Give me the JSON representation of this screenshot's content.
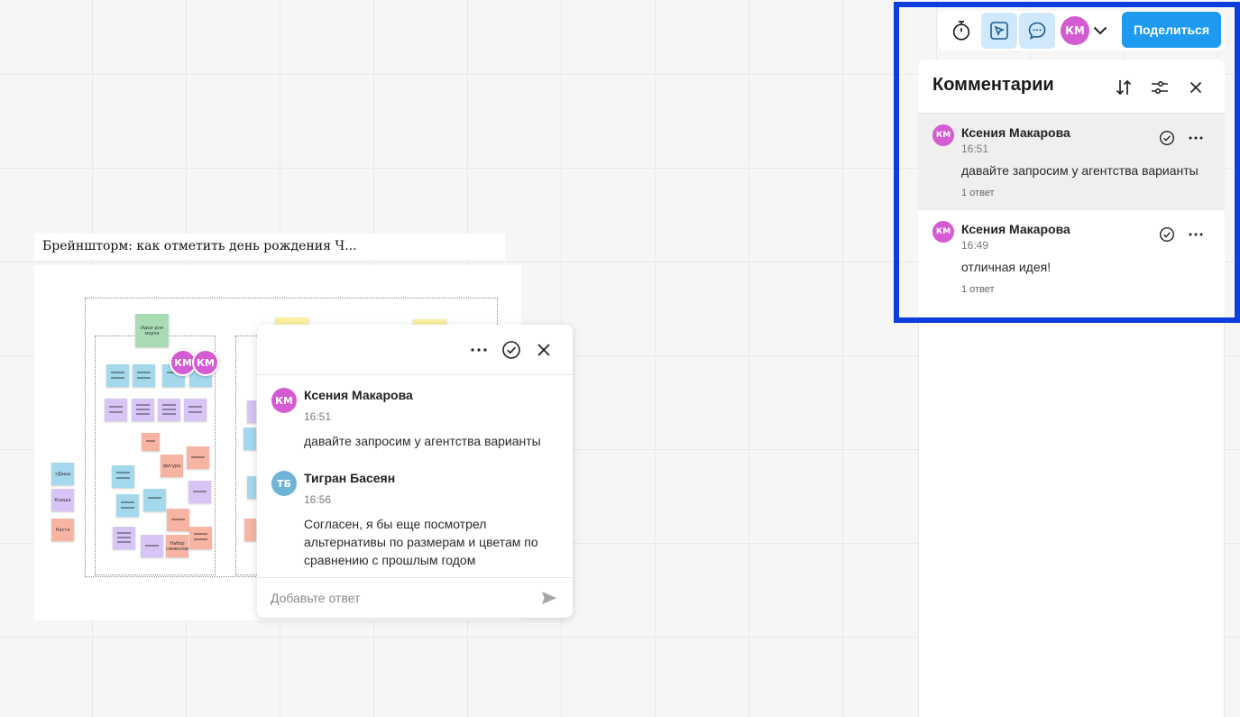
{
  "colors": {
    "accent": "#1e9bf0",
    "avatar_km": "#d45bd1",
    "avatar_tb": "#6fb3d6",
    "highlight_border": "#0d3ddc",
    "selected_row": "#efefef"
  },
  "board": {
    "frame_title": "Брейншторм: как отметить день рождения Ч...",
    "stickies": {
      "ideas": "Идеи для морча",
      "dasha": "•Даша",
      "ksyusha": "Ксюша",
      "nastya": "Настя",
      "figures": "фигура",
      "nabor": "Набор символов"
    },
    "avatar_initials": [
      "КМ",
      "КМ"
    ]
  },
  "thread": {
    "messages": [
      {
        "initials": "КМ",
        "author": "Ксения Макарова",
        "time": "16:51",
        "text": "давайте запросим у агентства варианты"
      },
      {
        "initials": "ТБ",
        "author": "Тигран Басеян",
        "time": "16:56",
        "text": "Согласен, я бы еще посмотрел альтернативы по размерам и цветам по сравнению с прошлым годом"
      }
    ],
    "reply_placeholder": "Добавьте ответ",
    "icons": [
      "more-icon",
      "resolve-check-icon",
      "close-icon",
      "send-icon"
    ]
  },
  "toolbar": {
    "user_initials": "КМ",
    "share_label": "Поделиться",
    "icons": [
      "timer-icon",
      "cursor-share-icon",
      "comments-icon",
      "chevron-down-icon"
    ]
  },
  "comments_panel": {
    "title": "Комментарии",
    "items": [
      {
        "initials": "КМ",
        "author": "Ксения Макарова",
        "time": "16:51",
        "text": "давайте запросим у агентства варианты",
        "replies": "1 ответ",
        "selected": true
      },
      {
        "initials": "КМ",
        "author": "Ксения Макарова",
        "time": "16:49",
        "text": "отличная идея!",
        "replies": "1 ответ",
        "selected": false
      }
    ],
    "icons": [
      "sort-icon",
      "filter-icon",
      "close-icon"
    ]
  }
}
